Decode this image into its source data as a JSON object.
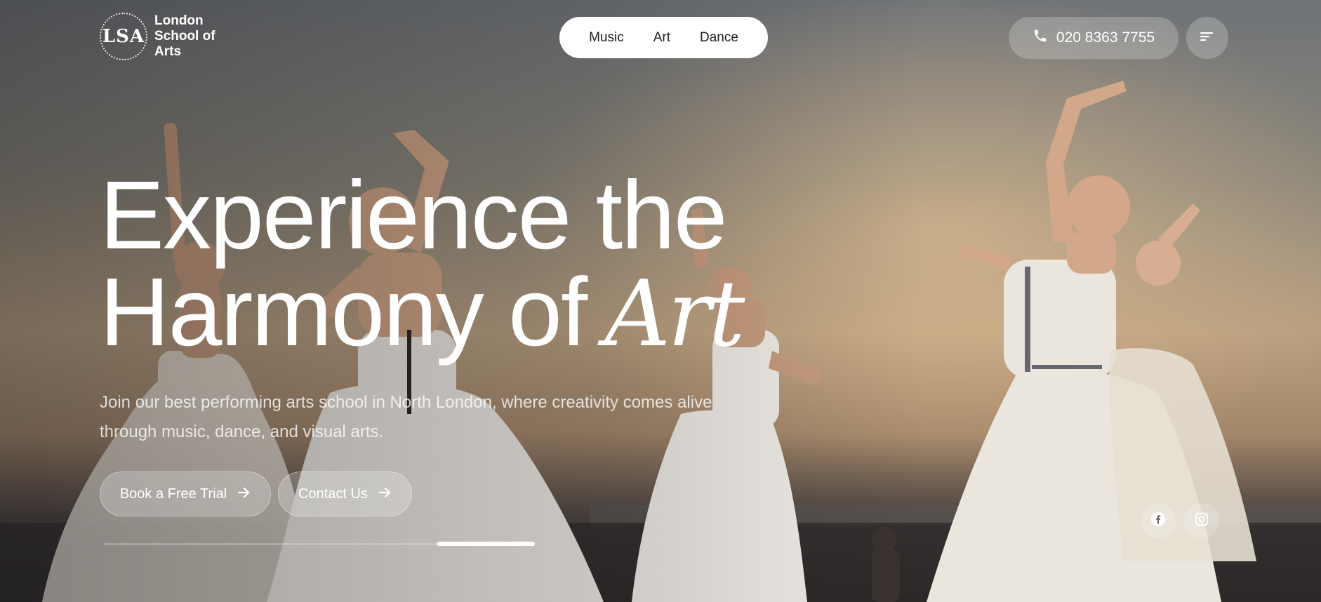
{
  "logo": {
    "mark": "LSA",
    "name_lines": [
      "London",
      "School of",
      "Arts"
    ]
  },
  "nav": {
    "items": [
      {
        "label": "Music"
      },
      {
        "label": "Art"
      },
      {
        "label": "Dance"
      }
    ]
  },
  "contact": {
    "phone": "020 8363 7755",
    "phone_icon": "phone-icon"
  },
  "menu": {
    "icon": "menu-lines-icon"
  },
  "hero": {
    "headline_line1": "Experience the",
    "headline_line2": "Harmony of",
    "headline_accent": "Art",
    "subtext_line1": "Join our best performing arts school in North London, where creativity comes alive",
    "subtext_line2": "through music, dance, and visual arts.",
    "primary_button": "Book a Free Trial",
    "secondary_button": "Contact Us",
    "slider_progress": 0.23
  },
  "social": [
    {
      "icon": "facebook-icon"
    },
    {
      "icon": "instagram-icon"
    }
  ],
  "colors": {
    "text": "#ffffff",
    "nav_bg": "#ffffff",
    "nav_text": "#1c1c1c",
    "glass": "rgba(255,255,255,0.22)"
  }
}
